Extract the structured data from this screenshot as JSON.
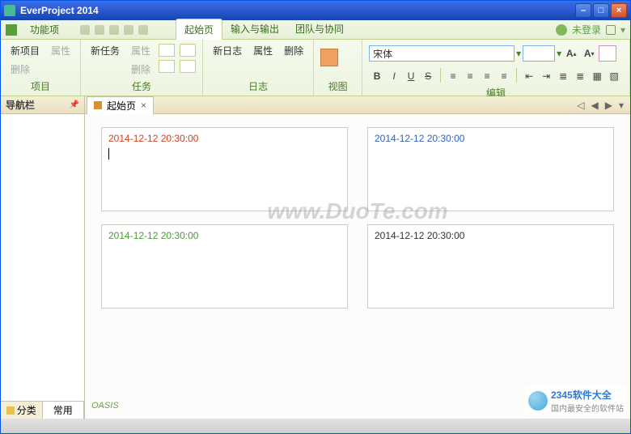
{
  "window": {
    "title": "EverProject 2014"
  },
  "menubar": {
    "main_tab": "功能项",
    "tabs": [
      "起始页",
      "输入与输出",
      "团队与协同"
    ],
    "active_tab": 0,
    "user_status": "未登录",
    "user_prefix": "▲"
  },
  "ribbon": {
    "project": {
      "new": "新项目",
      "prop": "属性",
      "del": "删除",
      "label": "项目"
    },
    "task": {
      "new": "新任务",
      "prop": "属性",
      "del": "删除",
      "label": "任务"
    },
    "journal": {
      "new": "新日志",
      "prop": "属性",
      "del": "删除",
      "label": "日志"
    },
    "view": {
      "label": "视图"
    },
    "edit": {
      "label": "编辑",
      "font_name": "宋体",
      "font_size": "",
      "a_big": "A",
      "a_small": "A",
      "b": "B",
      "i": "I",
      "u": "U",
      "s": "S"
    }
  },
  "sidebar": {
    "title": "导航栏",
    "tabs": [
      "分类",
      "常用"
    ],
    "active": 1
  },
  "doc": {
    "tab": "起始页",
    "nav": {
      "first": "◁",
      "prev": "◀",
      "next": "▶",
      "menu": "▾"
    }
  },
  "cards": [
    {
      "ts": "2014-12-12 20:30:00",
      "cls": "a"
    },
    {
      "ts": "2014-12-12 20:30:00",
      "cls": "b"
    },
    {
      "ts": "2014-12-12 20:30:00",
      "cls": "c"
    },
    {
      "ts": "2014-12-12 20:30:00",
      "cls": "d"
    }
  ],
  "watermark": "www.DuoTe.com",
  "footerlogo": "OASIS",
  "site": {
    "brand": "2345软件大全",
    "sub": "国内最安全的软件站"
  }
}
